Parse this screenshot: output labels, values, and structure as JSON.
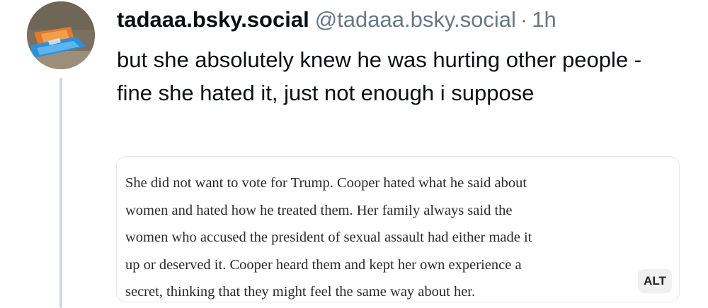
{
  "post": {
    "author_name": "tadaaa.bsky.social",
    "handle": "@tadaaa.bsky.social",
    "separator": "·",
    "time": "1h",
    "text": "but she absolutely knew he was hurting other people - fine she hated it, just not enough i suppose"
  },
  "embed_image": {
    "text_lines": [
      "She did not want to vote for Trump. Cooper hated what he said about",
      "women and hated how he treated them. Her family always said the",
      "women who accused the president of sexual assault had either made it",
      "up or deserved it. Cooper heard them and kept her own experience a",
      "secret, thinking that they might feel the same way about her."
    ],
    "alt_label": "ALT"
  },
  "icons": {
    "avatar": "avatar-photo"
  },
  "colors": {
    "text": "#0b0f14",
    "muted": "#6a7785",
    "thread_line": "#d4d9de",
    "card_border": "#e3e7eb",
    "alt_badge_bg": "#f0f0f0"
  }
}
